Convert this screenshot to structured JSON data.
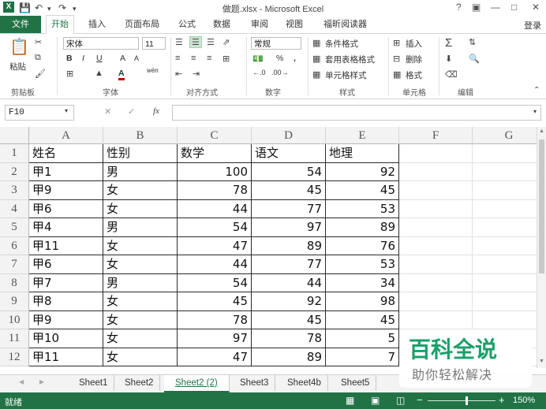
{
  "app": {
    "title": "做题.xlsx - Microsoft Excel",
    "login": "登录"
  },
  "ribbon_tabs": [
    "文件",
    "开始",
    "插入",
    "页面布局",
    "公式",
    "数据",
    "审阅",
    "视图",
    "福昕阅读器"
  ],
  "ribbon": {
    "clipboard": {
      "paste": "粘贴",
      "label": "剪贴板"
    },
    "font": {
      "name": "宋体",
      "size": "11",
      "bold": "B",
      "italic": "I",
      "underline": "U",
      "grow": "A",
      "shrink": "A",
      "label": "字体",
      "wen": "wén"
    },
    "alignment": {
      "label": "对齐方式"
    },
    "number": {
      "format": "常规",
      "percent": "%",
      "comma": ",",
      "label": "数字"
    },
    "styles": {
      "conditional": "条件格式",
      "table": "套用表格格式",
      "cell": "单元格样式",
      "label": "样式"
    },
    "cells": {
      "insert": "插入",
      "delete": "删除",
      "format": "格式",
      "label": "单元格"
    },
    "editing": {
      "label": "编辑"
    }
  },
  "formula_bar": {
    "name_box": "F10",
    "fx": "fx",
    "content": ""
  },
  "columns": [
    "A",
    "B",
    "C",
    "D",
    "E",
    "F",
    "G"
  ],
  "rows": [
    "1",
    "2",
    "3",
    "4",
    "5",
    "6",
    "7",
    "8",
    "9",
    "10",
    "11",
    "12"
  ],
  "table": {
    "header": [
      "姓名",
      "性别",
      "数学",
      "语文",
      "地理"
    ],
    "data": [
      [
        "甲1",
        "男",
        "100",
        "54",
        "92"
      ],
      [
        "甲9",
        "女",
        "78",
        "45",
        "45"
      ],
      [
        "甲6",
        "女",
        "44",
        "77",
        "53"
      ],
      [
        "甲4",
        "男",
        "54",
        "97",
        "89"
      ],
      [
        "甲11",
        "女",
        "47",
        "89",
        "76"
      ],
      [
        "甲6",
        "女",
        "44",
        "77",
        "53"
      ],
      [
        "甲7",
        "男",
        "54",
        "44",
        "34"
      ],
      [
        "甲8",
        "女",
        "45",
        "92",
        "98"
      ],
      [
        "甲9",
        "女",
        "78",
        "45",
        "45"
      ],
      [
        "甲10",
        "女",
        "97",
        "78",
        "5"
      ],
      [
        "甲11",
        "女",
        "47",
        "89",
        "7"
      ]
    ]
  },
  "sheet_tabs": [
    "Sheet1",
    "Sheet2",
    "Sheet2 (2)",
    "Sheet3",
    "Sheet4b",
    "Sheet5"
  ],
  "active_sheet": "Sheet2 (2)",
  "status": {
    "ready": "就绪",
    "zoom": "150%",
    "minus": "−",
    "plus": "+"
  },
  "watermark": {
    "main": "百科全说",
    "sub": "助你轻松解决"
  },
  "colors": {
    "accent": "#217346",
    "watermark": "#1aa06a"
  }
}
